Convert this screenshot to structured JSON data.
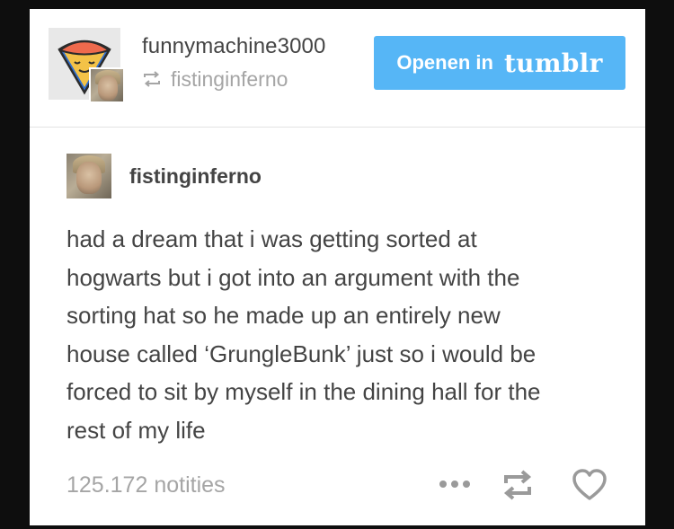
{
  "header": {
    "username": "funnymachine3000",
    "reblogged_from": "fistinginferno",
    "open_button": {
      "label": "Openen in",
      "brand": "tumblr"
    }
  },
  "post": {
    "author": "fistinginferno",
    "lines": [
      "had a dream that i was getting sorted at",
      "hogwarts but i got into an argument with the",
      "sorting hat so he made up an entirely new",
      "house called ‘GrungleBunk’ just so i would be",
      "forced to sit by myself in the dining hall for the",
      "rest of my life"
    ]
  },
  "footer": {
    "notes": "125.172 notities",
    "icons": [
      "more-dots-icon",
      "reblog-icon",
      "heart-icon"
    ]
  },
  "colors": {
    "page_background": "#0e0e0e",
    "card_background": "#ffffff",
    "button_blue": "#56b6f6",
    "text_dark": "#444444",
    "text_muted": "#a5a5a5",
    "icon_gray": "#9a9a9a"
  }
}
